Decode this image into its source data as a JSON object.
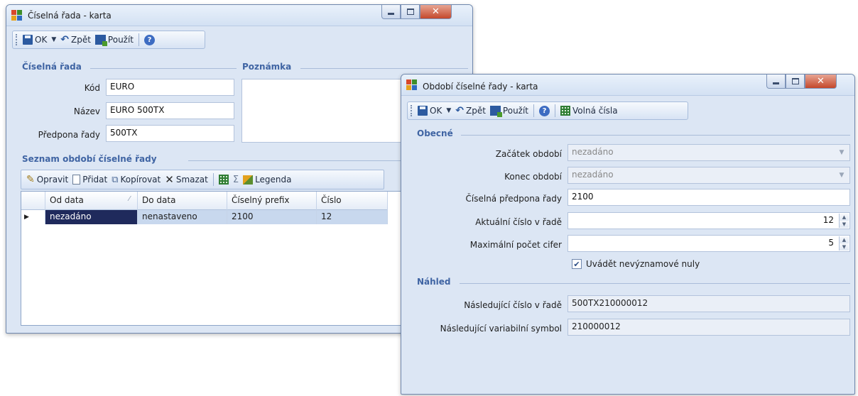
{
  "win1": {
    "title": "Číselná řada - karta",
    "toolbar": {
      "ok": "OK",
      "back": "Zpět",
      "apply": "Použít"
    },
    "section_series": "Číselná řada",
    "section_note": "Poznámka",
    "fields": {
      "code_label": "Kód",
      "code_value": "EURO",
      "name_label": "Název",
      "name_value": "EURO 500TX",
      "prefix_label": "Předpona řady",
      "prefix_value": "500TX"
    },
    "list_section": "Seznam období číselné řady",
    "list_toolbar": {
      "edit": "Opravit",
      "add": "Přidat",
      "copy": "Kopírovat",
      "delete": "Smazat",
      "legend": "Legenda"
    },
    "grid": {
      "columns": [
        "Od data",
        "Do data",
        "Číselný prefix",
        "Číslo"
      ],
      "rows": [
        {
          "from": "nezadáno",
          "to": "nenastaveno",
          "prefix": "2100",
          "number": "12"
        }
      ]
    }
  },
  "win2": {
    "title": "Období číselné řady - karta",
    "toolbar": {
      "ok": "OK",
      "back": "Zpět",
      "apply": "Použít",
      "free_numbers": "Volná čísla"
    },
    "section_general": "Obecné",
    "start_label": "Začátek období",
    "start_value": "nezadáno",
    "end_label": "Konec období",
    "end_value": "nezadáno",
    "prefix_label": "Číselná předpona řady",
    "prefix_value": "2100",
    "current_label": "Aktuální číslo v řadě",
    "current_value": "12",
    "maxdigits_label": "Maximální počet cifer",
    "maxdigits_value": "5",
    "zeros_label": "Uvádět nevýznamové nuly",
    "zeros_checked": true,
    "section_preview": "Náhled",
    "next_number_label": "Následující číslo v řadě",
    "next_number_value": "500TX210000012",
    "next_vs_label": "Následující variabilní symbol",
    "next_vs_value": "210000012"
  }
}
